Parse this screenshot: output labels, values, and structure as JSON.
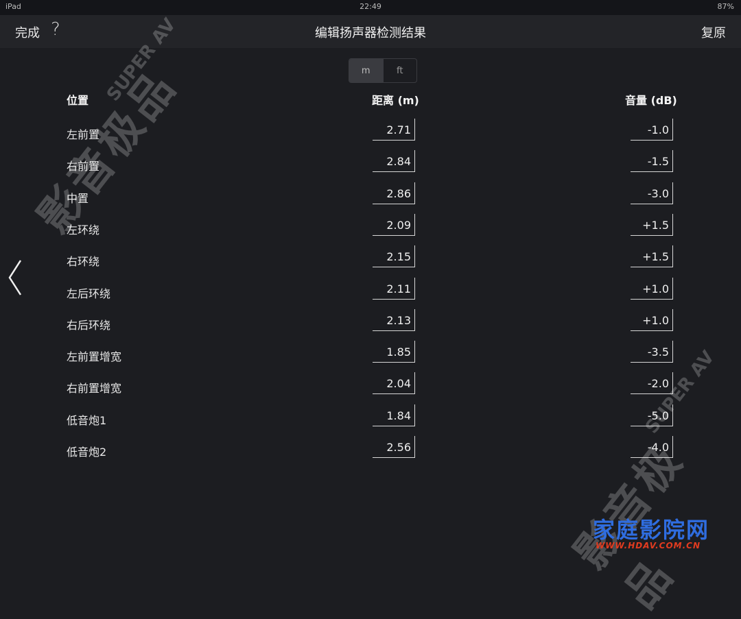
{
  "status": {
    "carrier": "iPad",
    "time": "22:49",
    "battery": "87%"
  },
  "nav": {
    "done": "完成",
    "help": "?",
    "title": "编辑扬声器检测结果",
    "restore": "复原"
  },
  "units": {
    "options": [
      "m",
      "ft"
    ],
    "selected": "m"
  },
  "table": {
    "headers": {
      "position": "位置",
      "distance": "距离 (m)",
      "volume": "音量 (dB)"
    },
    "rows": [
      {
        "label": "左前置",
        "distance": "2.71",
        "volume": "-1.0"
      },
      {
        "label": "右前置",
        "distance": "2.84",
        "volume": "-1.5"
      },
      {
        "label": "中置",
        "distance": "2.86",
        "volume": "-3.0"
      },
      {
        "label": "左环绕",
        "distance": "2.09",
        "volume": "+1.5"
      },
      {
        "label": "右环绕",
        "distance": "2.15",
        "volume": "+1.5"
      },
      {
        "label": "左后环绕",
        "distance": "2.11",
        "volume": "+1.0"
      },
      {
        "label": "右后环绕",
        "distance": "2.13",
        "volume": "+1.0"
      },
      {
        "label": "左前置增宽",
        "distance": "1.85",
        "volume": "-3.5"
      },
      {
        "label": "右前置增宽",
        "distance": "2.04",
        "volume": "-2.0"
      },
      {
        "label": "低音炮1",
        "distance": "1.84",
        "volume": "-5.0"
      },
      {
        "label": "低音炮2",
        "distance": "2.56",
        "volume": "-4.0"
      }
    ]
  },
  "watermark": {
    "logo": "影音极品",
    "sub": "SUPER AV",
    "brand": "家庭影院网",
    "url": "WWW.HDAV.COM.CN"
  },
  "icons": {
    "back": "chevron-left-icon",
    "wifi": "wifi-icon",
    "battery": "battery-icon"
  }
}
